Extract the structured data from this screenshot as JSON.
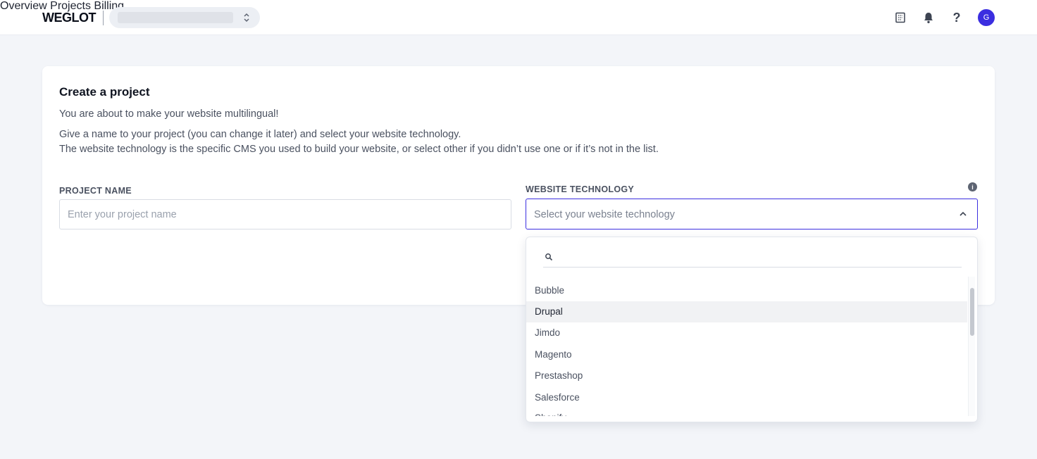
{
  "header": {
    "logo": "WEGLOT",
    "nav": [
      "Overview",
      "Projects",
      "Billing"
    ],
    "avatar_initial": "G",
    "accent_color": "#3b2ee0"
  },
  "card": {
    "title": "Create a project",
    "intro": "You are about to make your website multilingual!",
    "desc_line1": "Give a name to your project (you can change it later) and select your website technology.",
    "desc_line2": "The website technology is the specific CMS you used to build your website, or select other if you didn’t use one or if it’s not in the list.",
    "project_name_label": "PROJECT NAME",
    "project_name_placeholder": "Enter your project name",
    "tech_label": "WEBSITE TECHNOLOGY",
    "tech_placeholder": "Select your website technology"
  },
  "dropdown": {
    "search_value": "",
    "options": [
      "Bubble",
      "Drupal",
      "Jimdo",
      "Magento",
      "Prestashop",
      "Salesforce",
      "Shopify"
    ],
    "highlighted": "Drupal"
  },
  "icons": [
    "updown-icon",
    "book-icon",
    "bell-icon",
    "help-icon",
    "info-icon",
    "chevron-up-icon",
    "search-icon"
  ]
}
